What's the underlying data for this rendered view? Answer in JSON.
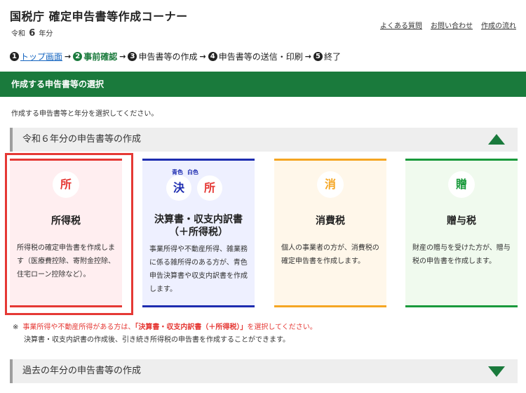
{
  "header": {
    "title": "国税庁 確定申告書等作成コーナー",
    "era": "令和",
    "year": "6",
    "year_suffix": "年分",
    "links": [
      "よくある質問",
      "お問い合わせ",
      "作成の流れ"
    ]
  },
  "steps": [
    {
      "num": "1",
      "label": "トップ画面",
      "state": "link"
    },
    {
      "num": "2",
      "label": "事前確認",
      "state": "current"
    },
    {
      "num": "3",
      "label": "申告書等の作成",
      "state": "todo"
    },
    {
      "num": "4",
      "label": "申告書等の送信・印刷",
      "state": "todo"
    },
    {
      "num": "5",
      "label": "終了",
      "state": "todo"
    }
  ],
  "section_title": "作成する申告書等の選択",
  "instruction": "作成する申告書等と年分を選択してください。",
  "current_year_accordion": {
    "label": "令和６年分の申告書等の作成",
    "expanded": true
  },
  "cards": [
    {
      "icon": "所",
      "title": "所得税",
      "desc": "所得税の確定申告書を作成します（医療費控除、寄附金控除、住宅ローン控除など）。",
      "selected": true
    },
    {
      "icon_tag_blue": "青色",
      "icon_tag_white": "白色",
      "icon_a": "決",
      "icon_b": "所",
      "title_line1": "決算書・収支内訳書",
      "title_line2": "（＋所得税）",
      "desc": "事業所得や不動産所得、雑業務に係る雑所得のある方が、青色申告決算書や収支内訳書を作成します。"
    },
    {
      "icon": "消",
      "title": "消費税",
      "desc": "個人の事業者の方が、消費税の確定申告書を作成します。"
    },
    {
      "icon": "贈",
      "title": "贈与税",
      "desc": "財産の贈与を受けた方が、贈与税の申告書を作成します。"
    }
  ],
  "note": {
    "mark": "※",
    "part1": "事業所得や不動産所得がある方は、",
    "part2": "「決算書・収支内訳書（＋所得税）」",
    "part3": "を選択してください。",
    "line2": "決算書・収支内訳書の作成後、引き続き所得税の申告書を作成することができます。"
  },
  "past_year_accordion": {
    "label": "過去の年分の申告書等の作成",
    "expanded": false
  },
  "colors": {
    "primary_green": "#1a7a3c",
    "income_red": "#e53935",
    "accounts_blue": "#1e2db0",
    "consumption_orange": "#f5a623",
    "gift_green": "#1a9a3c"
  }
}
